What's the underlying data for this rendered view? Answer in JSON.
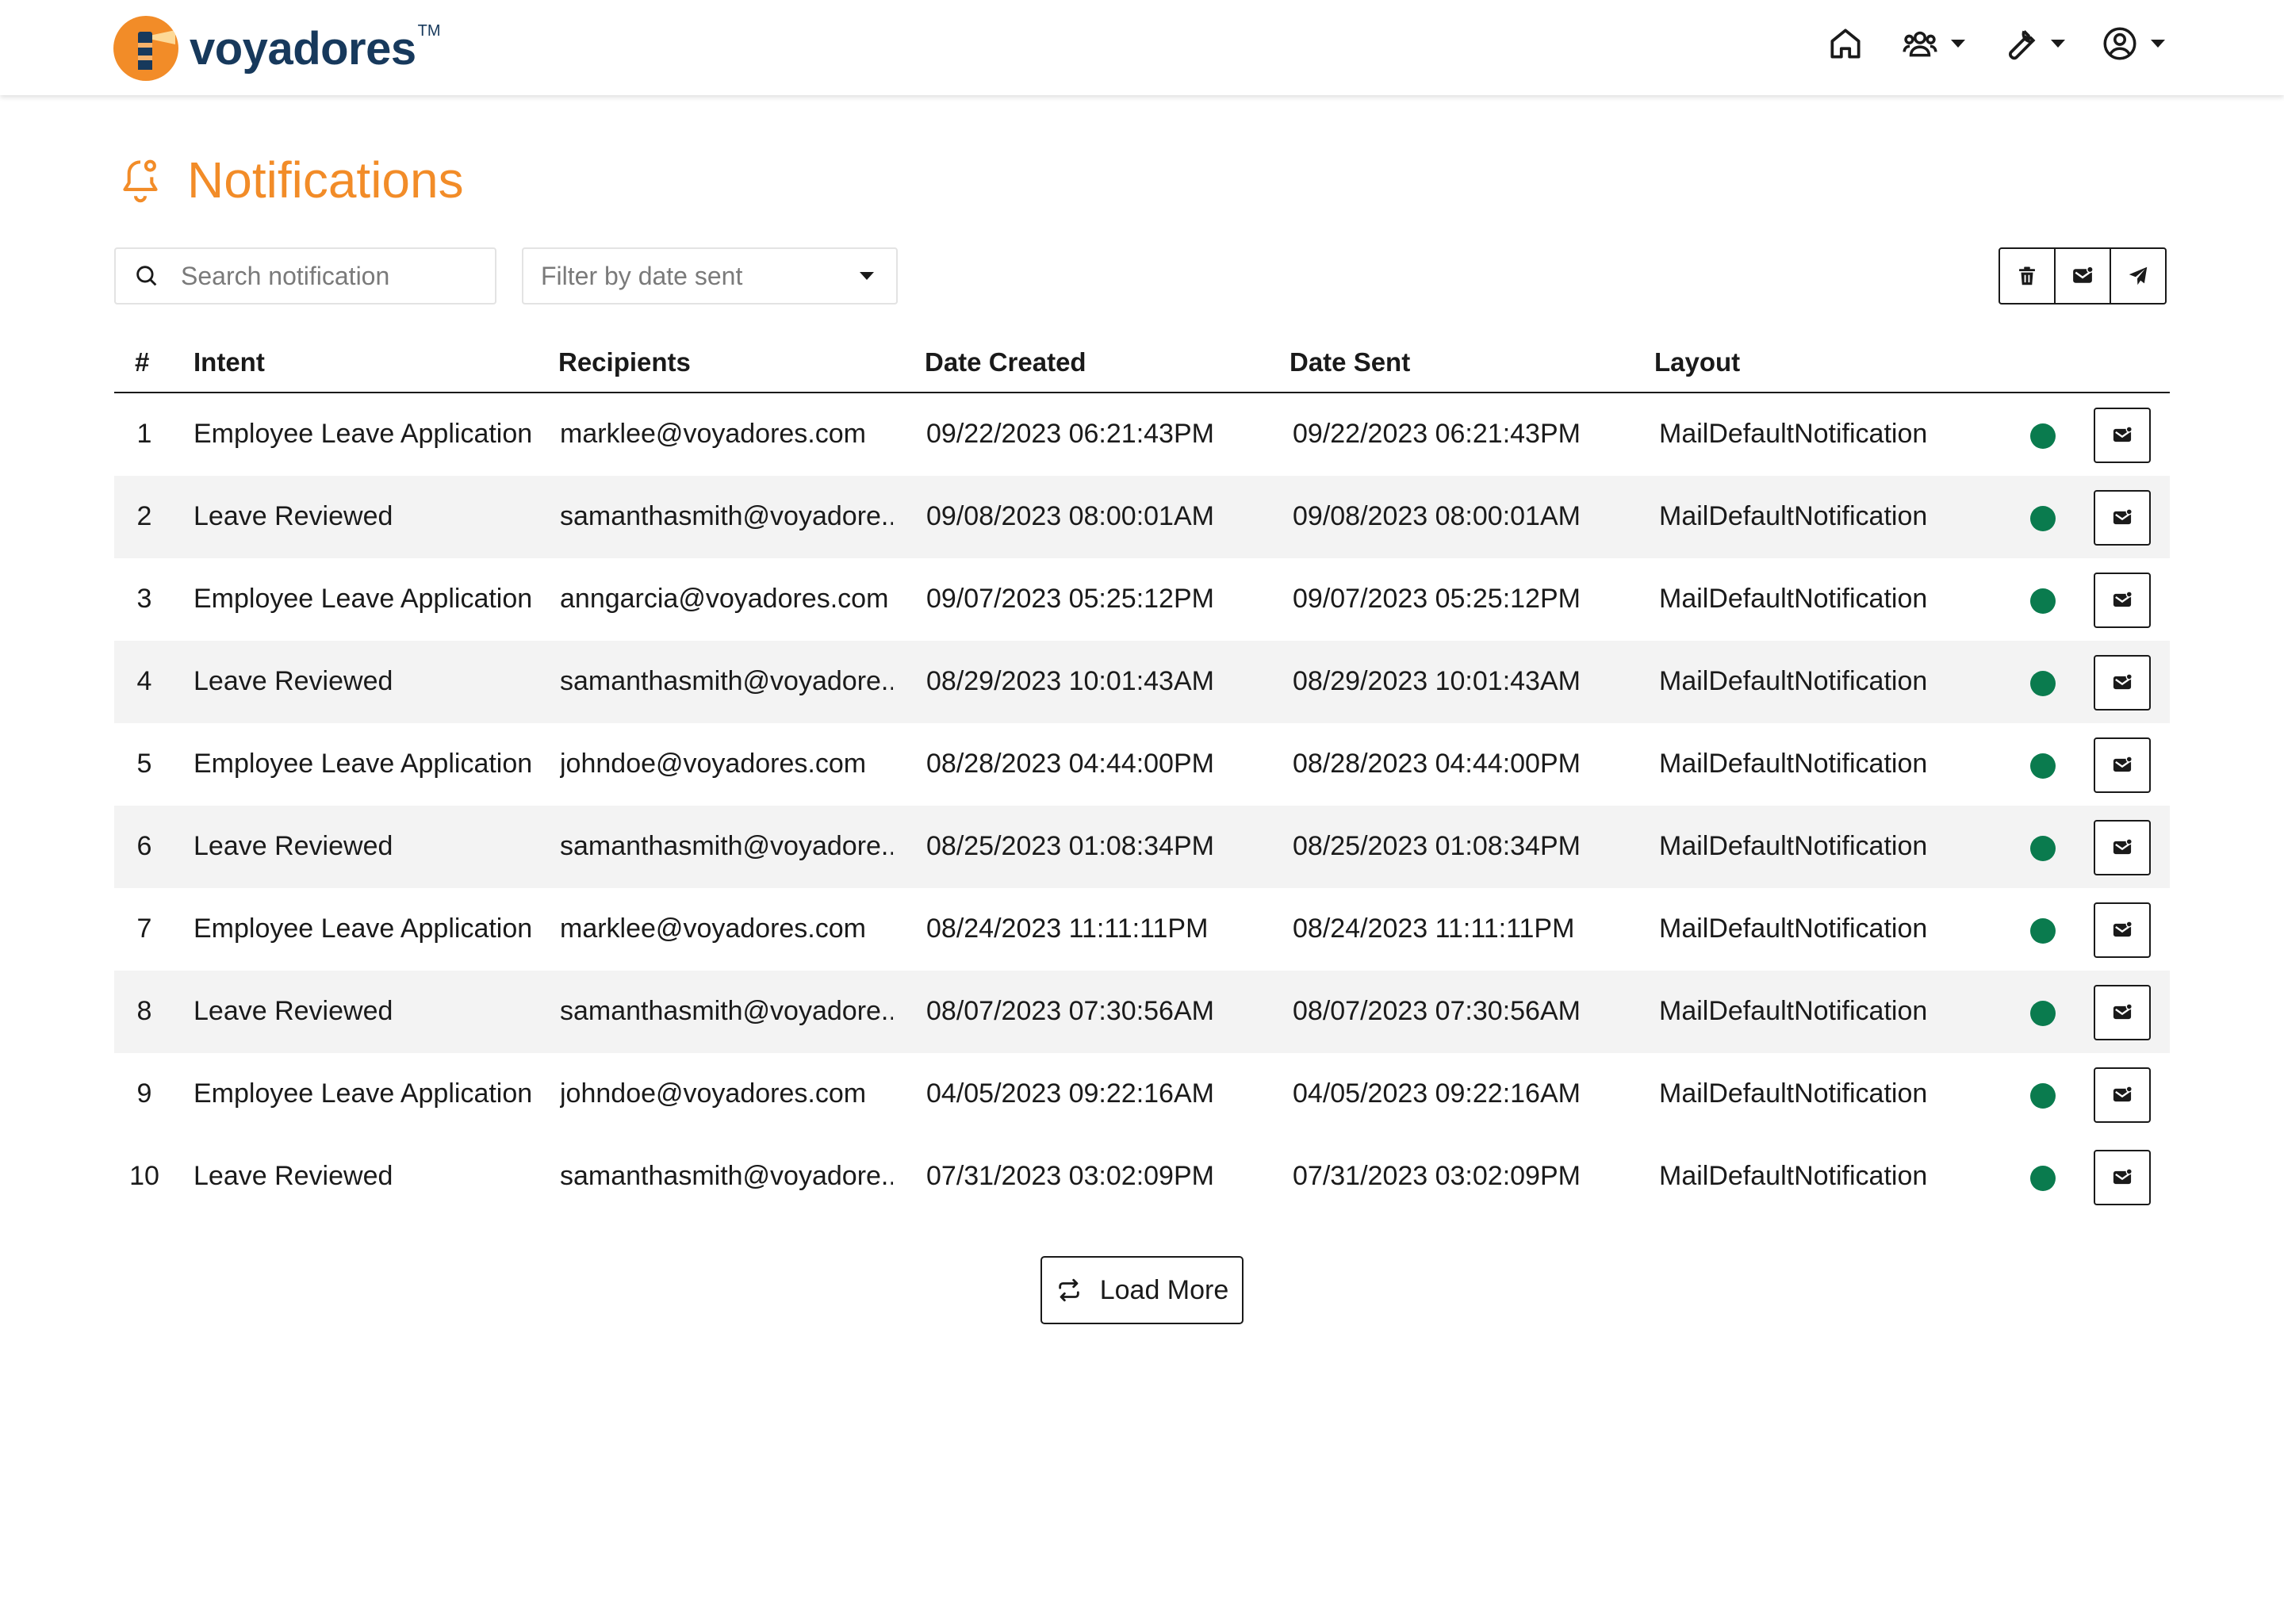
{
  "brand": {
    "name": "voyadores",
    "tm": "TM",
    "color": "#17395C",
    "accent": "#F28C28"
  },
  "nav": {
    "items": [
      {
        "icon": "home-icon",
        "has_caret": false
      },
      {
        "icon": "users-icon",
        "has_caret": true
      },
      {
        "icon": "wrench-icon",
        "has_caret": true
      },
      {
        "icon": "user-circle-icon",
        "has_caret": true
      }
    ]
  },
  "page": {
    "title": "Notifications",
    "title_icon": "bell-icon"
  },
  "search": {
    "placeholder": "Search notification",
    "icon": "search-icon"
  },
  "filter": {
    "placeholder": "Filter by date sent"
  },
  "actions": [
    {
      "icon": "trash-icon"
    },
    {
      "icon": "mail-icon"
    },
    {
      "icon": "send-icon"
    }
  ],
  "table": {
    "columns": [
      "#",
      "Intent",
      "Recipients",
      "Date Created",
      "Date Sent",
      "Layout"
    ],
    "status_color": "#0A7B4E",
    "rows": [
      {
        "num": "1",
        "intent": "Employee Leave Application",
        "recipient": "marklee@voyadores.com",
        "created": "09/22/2023 06:21:43PM",
        "sent": "09/22/2023 06:21:43PM",
        "layout": "MailDefaultNotification"
      },
      {
        "num": "2",
        "intent": "Leave Reviewed",
        "recipient": "samanthasmith@voyadore...",
        "created": "09/08/2023 08:00:01AM",
        "sent": "09/08/2023 08:00:01AM",
        "layout": "MailDefaultNotification"
      },
      {
        "num": "3",
        "intent": "Employee Leave Application",
        "recipient": "anngarcia@voyadores.com",
        "created": "09/07/2023 05:25:12PM",
        "sent": "09/07/2023 05:25:12PM",
        "layout": "MailDefaultNotification"
      },
      {
        "num": "4",
        "intent": "Leave Reviewed",
        "recipient": "samanthasmith@voyadore...",
        "created": "08/29/2023 10:01:43AM",
        "sent": "08/29/2023 10:01:43AM",
        "layout": "MailDefaultNotification"
      },
      {
        "num": "5",
        "intent": "Employee Leave Application",
        "recipient": "johndoe@voyadores.com",
        "created": "08/28/2023 04:44:00PM",
        "sent": "08/28/2023 04:44:00PM",
        "layout": "MailDefaultNotification"
      },
      {
        "num": "6",
        "intent": "Leave Reviewed",
        "recipient": "samanthasmith@voyadore...",
        "created": "08/25/2023 01:08:34PM",
        "sent": "08/25/2023 01:08:34PM",
        "layout": "MailDefaultNotification"
      },
      {
        "num": "7",
        "intent": "Employee Leave Application",
        "recipient": "marklee@voyadores.com",
        "created": "08/24/2023 11:11:11PM",
        "sent": "08/24/2023 11:11:11PM",
        "layout": "MailDefaultNotification"
      },
      {
        "num": "8",
        "intent": "Leave Reviewed",
        "recipient": "samanthasmith@voyadore...",
        "created": "08/07/2023 07:30:56AM",
        "sent": "08/07/2023 07:30:56AM",
        "layout": "MailDefaultNotification"
      },
      {
        "num": "9",
        "intent": "Employee Leave Application",
        "recipient": "johndoe@voyadores.com",
        "created": "04/05/2023 09:22:16AM",
        "sent": "04/05/2023 09:22:16AM",
        "layout": "MailDefaultNotification"
      },
      {
        "num": "10",
        "intent": "Leave Reviewed",
        "recipient": "samanthasmith@voyadore...",
        "created": "07/31/2023 03:02:09PM",
        "sent": "07/31/2023 03:02:09PM",
        "layout": "MailDefaultNotification"
      }
    ]
  },
  "load_more": {
    "label": "Load More",
    "icon": "refresh-icon"
  }
}
